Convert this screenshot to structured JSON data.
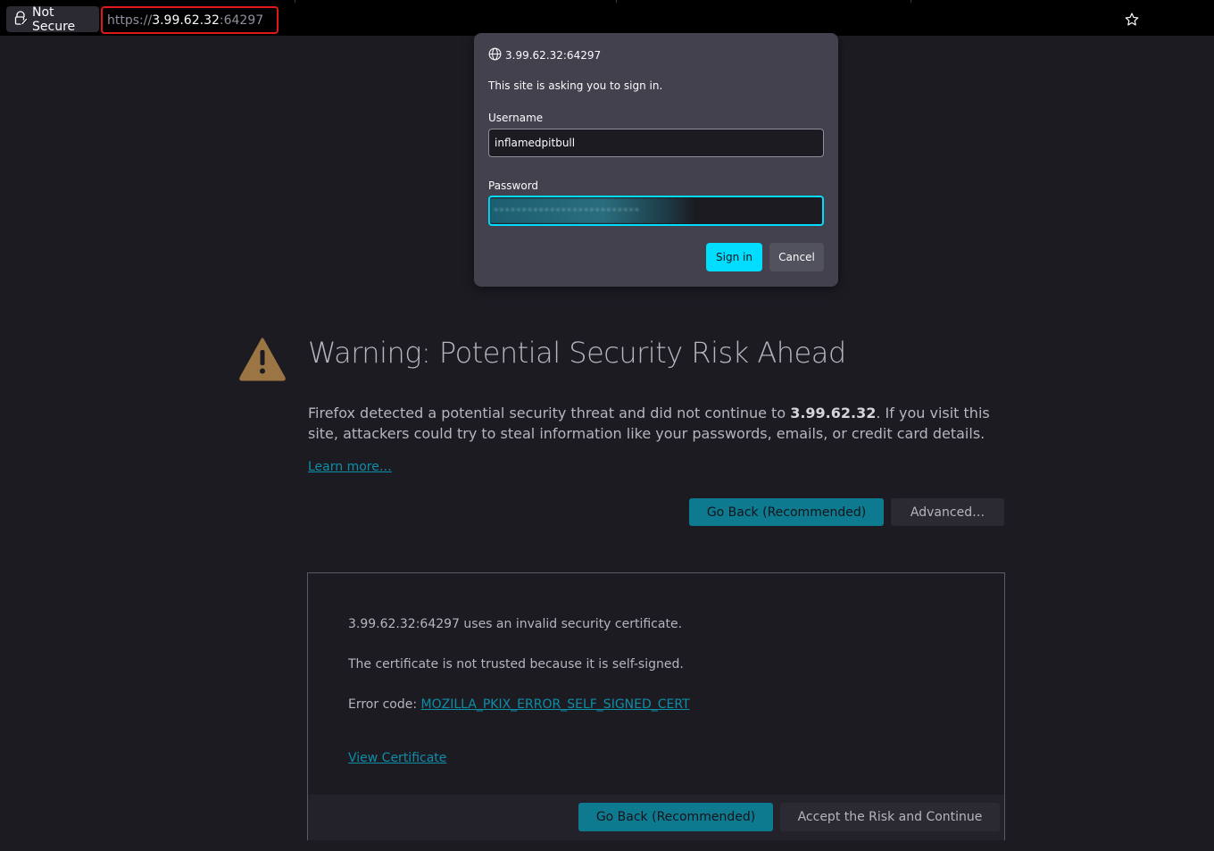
{
  "toolbar": {
    "security_label": "Not Secure",
    "url_scheme": "https://",
    "url_host": "3.99.62.32",
    "url_port": ":64297"
  },
  "auth_dialog": {
    "origin": "3.99.62.32:64297",
    "message": "This site is asking you to sign in.",
    "username_label": "Username",
    "username_value": "inflamedpitbull",
    "password_label": "Password",
    "sign_in_label": "Sign in",
    "cancel_label": "Cancel"
  },
  "warning": {
    "title": "Warning: Potential Security Risk Ahead",
    "desc_before": "Firefox detected a potential security threat and did not continue to ",
    "desc_host": "3.99.62.32",
    "desc_after": ". If you visit this site, attackers could try to steal information like your passwords, emails, or credit card details.",
    "learn_more": "Learn more…",
    "go_back_label": "Go Back (Recommended)",
    "advanced_label": "Advanced…"
  },
  "advanced": {
    "invalid_cert": "3.99.62.32:64297 uses an invalid security certificate.",
    "not_trusted": "The certificate is not trusted because it is self-signed.",
    "error_code_label": "Error code: ",
    "error_code": "MOZILLA_PKIX_ERROR_SELF_SIGNED_CERT",
    "view_certificate": "View Certificate",
    "go_back_label": "Go Back (Recommended)",
    "accept_label": "Accept the Risk and Continue"
  },
  "colors": {
    "accent": "#00ddff",
    "primary_button": "#0e7a8f",
    "link": "#0f8ea7",
    "warning_icon": "#9b7543",
    "url_highlight_border": "#e01818",
    "page_background": "#1c1b22"
  },
  "icons": {
    "lock": "lock-warning-icon",
    "star": "bookmark-star-icon",
    "globe": "globe-icon",
    "warning": "warning-triangle-icon"
  }
}
